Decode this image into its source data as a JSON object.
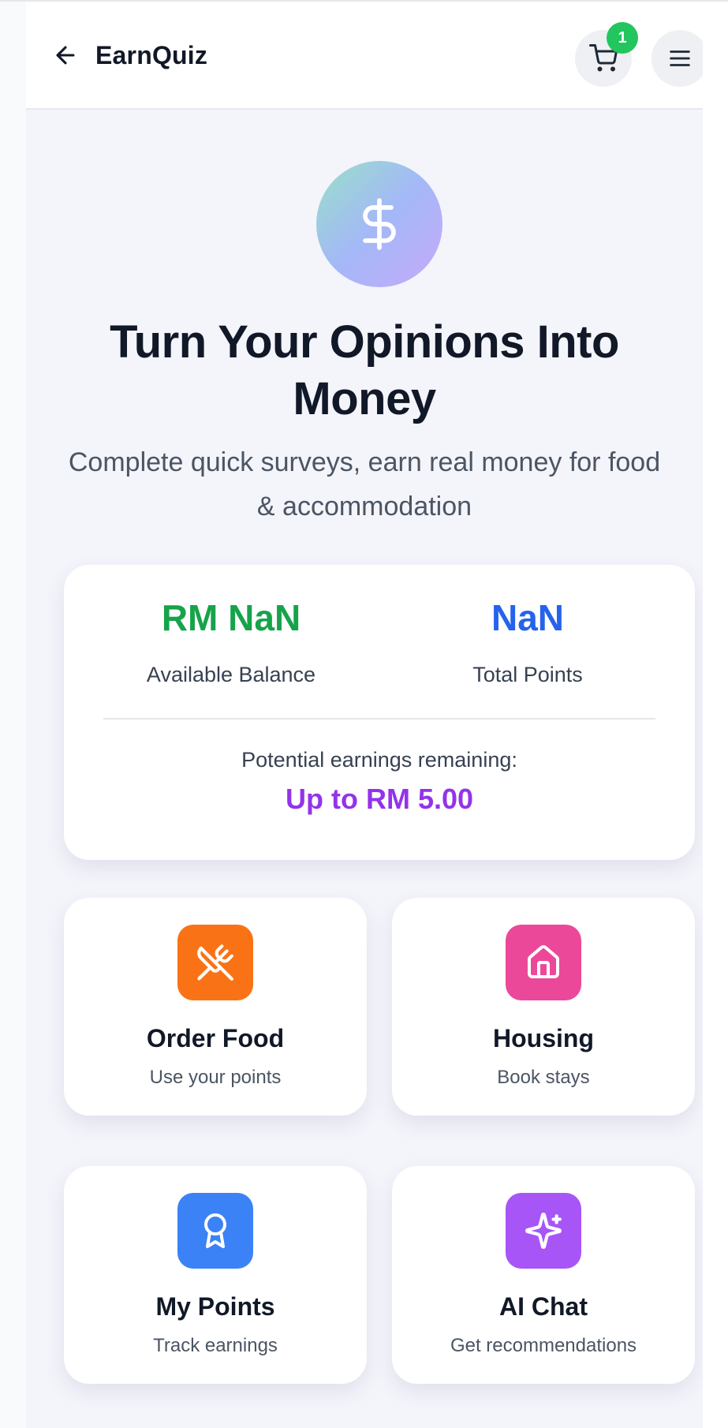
{
  "header": {
    "title": "EarnQuiz",
    "cart_count": "1"
  },
  "hero": {
    "title": "Turn Your Opinions Into Money",
    "subtitle": "Complete quick surveys, earn real money for food & accommodation"
  },
  "stats": {
    "balance_value": "RM NaN",
    "balance_label": "Available Balance",
    "points_value": "NaN",
    "points_label": "Total Points",
    "potential_label": "Potential earnings remaining:",
    "potential_value": "Up to RM 5.00"
  },
  "features": [
    {
      "title": "Order Food",
      "subtitle": "Use your points",
      "icon": "utensils-icon",
      "color": "#f97316"
    },
    {
      "title": "Housing",
      "subtitle": "Book stays",
      "icon": "home-icon",
      "color": "#ec4899"
    },
    {
      "title": "My Points",
      "subtitle": "Track earnings",
      "icon": "award-icon",
      "color": "#3b82f6"
    },
    {
      "title": "AI Chat",
      "subtitle": "Get recommendations",
      "icon": "sparkles-icon",
      "color": "#a855f7"
    }
  ],
  "colors": {
    "balance": "#16a34a",
    "points": "#2563eb",
    "potential": "#9333ea",
    "badge": "#22c55e"
  }
}
